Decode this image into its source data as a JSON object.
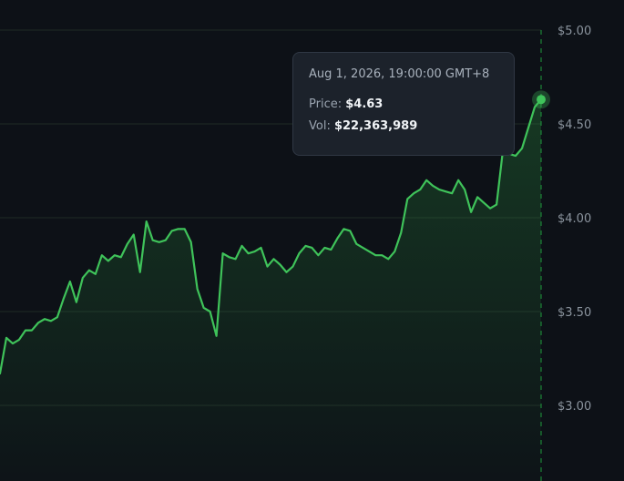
{
  "colors": {
    "background": "#0d1117",
    "line": "#3fc35a",
    "grid": "#1f2a26",
    "crosshair": "#1f9b3d",
    "tick_text": "#8b949e"
  },
  "tooltip": {
    "date": "Aug 1, 2026, 19:00:00 GMT+8",
    "price_label": "Price: ",
    "price_value": "$4.63",
    "vol_label": "Vol: ",
    "vol_value": "$22,363,989"
  },
  "chart_data": {
    "type": "area",
    "x_count": 118,
    "ylim": [
      2.6,
      5.0
    ],
    "y_ticks": [
      {
        "value": 5.0,
        "label": "$5.00"
      },
      {
        "value": 4.5,
        "label": "$4.50"
      },
      {
        "value": 4.0,
        "label": "$4.00"
      },
      {
        "value": 3.5,
        "label": "$3.50"
      },
      {
        "value": 3.0,
        "label": "$3.00"
      }
    ],
    "grid": true,
    "highlight_index": 117,
    "series": [
      {
        "values": [
          3.17,
          3.36,
          3.33,
          3.35,
          3.4,
          3.4,
          3.44,
          3.46,
          3.45,
          3.47,
          3.57,
          3.66,
          3.55,
          3.68,
          3.72,
          3.7,
          3.8,
          3.77,
          3.8,
          3.79,
          3.86,
          3.91,
          3.71,
          3.98,
          3.88,
          3.87,
          3.88,
          3.93,
          3.94,
          3.94,
          3.87,
          3.62,
          3.52,
          3.5,
          3.37,
          3.81,
          3.79,
          3.78,
          3.85,
          3.81,
          3.82,
          3.84,
          3.74,
          3.78,
          3.75,
          3.71,
          3.74,
          3.81,
          3.85,
          3.84,
          3.8,
          3.84,
          3.83,
          3.89,
          3.94,
          3.93,
          3.86,
          3.84,
          3.82,
          3.8,
          3.8,
          3.78,
          3.82,
          3.92,
          4.1,
          4.13,
          4.15,
          4.2,
          4.17,
          4.15,
          4.14,
          4.13,
          4.2,
          4.15,
          4.03,
          4.11,
          4.08,
          4.05,
          4.07,
          4.36,
          4.34,
          4.33,
          4.37,
          4.48,
          4.59,
          4.63
        ]
      }
    ]
  }
}
